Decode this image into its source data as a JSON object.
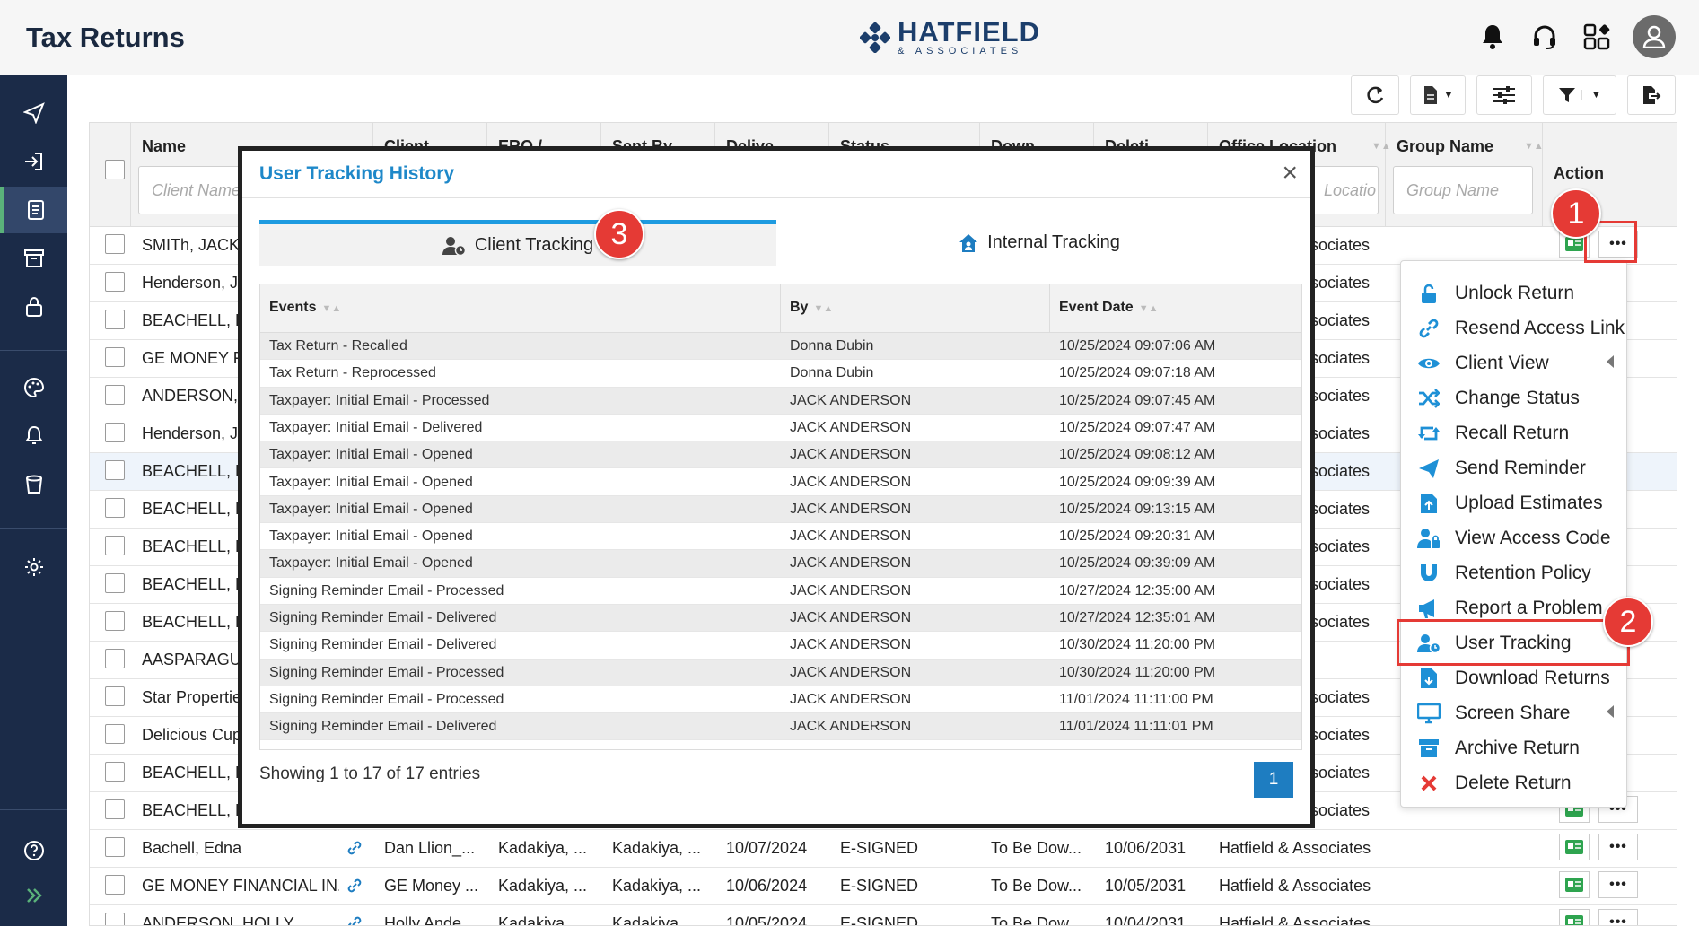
{
  "header": {
    "title": "Tax Returns",
    "logo_main": "HATFIELD",
    "logo_sub": "& ASSOCIATES"
  },
  "sidebar": {
    "items": [
      "send-icon",
      "login-icon",
      "document-icon",
      "archive-icon",
      "lock-icon",
      "palette-icon",
      "bell-icon",
      "trash-icon",
      "gear-icon",
      "help-icon",
      "expand-icon"
    ]
  },
  "grid": {
    "columns": [
      "Name",
      "Client",
      "ERO /",
      "Sent By",
      "Delive",
      "Status",
      "Down",
      "Deleti",
      "Office Location",
      "Group Name",
      "Action"
    ],
    "name_placeholder": "Client Name",
    "office_placeholder": "Locatio",
    "group_placeholder": "Group Name",
    "rows": [
      {
        "name": "SMITh, JACK",
        "office": "sociates"
      },
      {
        "name": "Henderson, Ja",
        "office": "sociates"
      },
      {
        "name": "BEACHELL, ED",
        "office": "sociates"
      },
      {
        "name": "GE MONEY FI",
        "office": "sociates"
      },
      {
        "name": "ANDERSON, J",
        "office": "sociates"
      },
      {
        "name": "Henderson, Ja",
        "office": "sociates"
      },
      {
        "name": "BEACHELL, ED",
        "office": "sociates"
      },
      {
        "name": "BEACHELL, ED",
        "office": "sociates"
      },
      {
        "name": "BEACHELL, ED",
        "office": "sociates"
      },
      {
        "name": "BEACHELL, ED",
        "office": "sociates"
      },
      {
        "name": "BEACHELL, ED",
        "office": "sociates"
      },
      {
        "name": "AASPARAGUS",
        "office": ""
      },
      {
        "name": "Star Propertie",
        "office": "sociates"
      },
      {
        "name": "Delicious Cup",
        "office": "sociates"
      },
      {
        "name": "BEACHELL, ED",
        "office": "sociates"
      },
      {
        "name": "BEACHELL, ED",
        "office": "sociates"
      }
    ],
    "full_rows": [
      {
        "name": "Bachell, Edna",
        "client": "Dan Llion_...",
        "ero": "Kadakiya, ...",
        "sent": "Kadakiya, ...",
        "deliv": "10/07/2024",
        "status": "E-SIGNED",
        "down": "To Be Dow...",
        "del": "10/06/2031",
        "office": "Hatfield & Associates"
      },
      {
        "name": "GE MONEY FINANCIAL IN...",
        "client": "GE Money ...",
        "ero": "Kadakiya, ...",
        "sent": "Kadakiya, ...",
        "deliv": "10/06/2024",
        "status": "E-SIGNED",
        "down": "To Be Dow...",
        "del": "10/05/2031",
        "office": "Hatfield & Associates"
      },
      {
        "name": "ANDERSON, HOLLY",
        "client": "Holly Ande...",
        "ero": "Kadakiya, ...",
        "sent": "Kadakiya, ...",
        "deliv": "10/05/2024",
        "status": "E-SIGNED",
        "down": "To Be Dow...",
        "del": "10/04/2031",
        "office": "Hatfield & Associates"
      }
    ]
  },
  "modal": {
    "title": "User Tracking History",
    "close": "×",
    "tab_client": "Client Tracking",
    "tab_internal": "Internal Tracking",
    "col_events": "Events",
    "col_by": "By",
    "col_date": "Event Date",
    "rows": [
      {
        "event": "Tax Return - Recalled",
        "by": "Donna Dubin",
        "date": "10/25/2024 09:07:06 AM"
      },
      {
        "event": "Tax Return - Reprocessed",
        "by": "Donna Dubin",
        "date": "10/25/2024 09:07:18 AM"
      },
      {
        "event": "Taxpayer: Initial Email - Processed",
        "by": "JACK ANDERSON",
        "date": "10/25/2024 09:07:45 AM"
      },
      {
        "event": "Taxpayer: Initial Email - Delivered",
        "by": "JACK ANDERSON",
        "date": "10/25/2024 09:07:47 AM"
      },
      {
        "event": "Taxpayer: Initial Email - Opened",
        "by": "JACK ANDERSON",
        "date": "10/25/2024 09:08:12 AM"
      },
      {
        "event": "Taxpayer: Initial Email - Opened",
        "by": "JACK ANDERSON",
        "date": "10/25/2024 09:09:39 AM"
      },
      {
        "event": "Taxpayer: Initial Email - Opened",
        "by": "JACK ANDERSON",
        "date": "10/25/2024 09:13:15 AM"
      },
      {
        "event": "Taxpayer: Initial Email - Opened",
        "by": "JACK ANDERSON",
        "date": "10/25/2024 09:20:31 AM"
      },
      {
        "event": "Taxpayer: Initial Email - Opened",
        "by": "JACK ANDERSON",
        "date": "10/25/2024 09:39:09 AM"
      },
      {
        "event": "Signing Reminder Email - Processed",
        "by": "JACK ANDERSON",
        "date": "10/27/2024 12:35:00 AM"
      },
      {
        "event": "Signing Reminder Email - Delivered",
        "by": "JACK ANDERSON",
        "date": "10/27/2024 12:35:01 AM"
      },
      {
        "event": "Signing Reminder Email - Delivered",
        "by": "JACK ANDERSON",
        "date": "10/30/2024 11:20:00 PM"
      },
      {
        "event": "Signing Reminder Email - Processed",
        "by": "JACK ANDERSON",
        "date": "10/30/2024 11:20:00 PM"
      },
      {
        "event": "Signing Reminder Email - Processed",
        "by": "JACK ANDERSON",
        "date": "11/01/2024 11:11:00 PM"
      },
      {
        "event": "Signing Reminder Email - Delivered",
        "by": "JACK ANDERSON",
        "date": "11/01/2024 11:11:01 PM"
      }
    ],
    "showing": "Showing 1 to 17 of 17 entries",
    "page": "1"
  },
  "context_menu": {
    "items": [
      {
        "label": "Unlock Return",
        "icon": "unlock-icon",
        "color": "#1e90d6"
      },
      {
        "label": "Resend Access Link",
        "icon": "link-icon",
        "color": "#1e90d6"
      },
      {
        "label": "Client View",
        "icon": "eye-icon",
        "color": "#1e90d6"
      },
      {
        "label": "Change Status",
        "icon": "shuffle-icon",
        "color": "#1e90d6"
      },
      {
        "label": "Recall Return",
        "icon": "retweet-icon",
        "color": "#1e90d6"
      },
      {
        "label": "Send Reminder",
        "icon": "paper-plane-icon",
        "color": "#1e90d6"
      },
      {
        "label": "Upload Estimates",
        "icon": "file-upload-icon",
        "color": "#1e90d6"
      },
      {
        "label": "View Access Code",
        "icon": "user-lock-icon",
        "color": "#1e90d6"
      },
      {
        "label": "Retention Policy",
        "icon": "magnet-icon",
        "color": "#1e90d6"
      },
      {
        "label": "Report a Problem",
        "icon": "megaphone-icon",
        "color": "#1e90d6"
      },
      {
        "label": "User Tracking",
        "icon": "user-clock-icon",
        "color": "#1e90d6"
      },
      {
        "label": "Download Returns",
        "icon": "file-download-icon",
        "color": "#1e90d6"
      },
      {
        "label": "Screen Share",
        "icon": "desktop-icon",
        "color": "#1e90d6"
      },
      {
        "label": "Archive Return",
        "icon": "archive-icon",
        "color": "#1e90d6"
      },
      {
        "label": "Delete Return",
        "icon": "x-icon",
        "color": "#e53a35"
      }
    ]
  },
  "annotations": {
    "badge1": "1",
    "badge2": "2",
    "badge3": "3"
  }
}
